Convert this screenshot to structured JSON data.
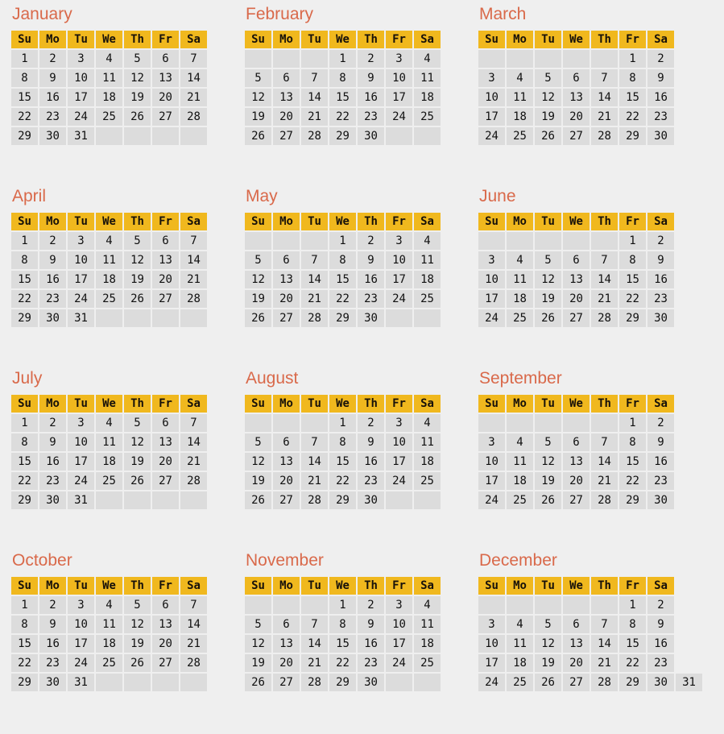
{
  "calendar": {
    "weekday_headers": [
      "Su",
      "Mo",
      "Tu",
      "We",
      "Th",
      "Fr",
      "Sa"
    ],
    "colors": {
      "page_background": "#EFEFEF",
      "header_cell_background": "#F0B81E",
      "header_cell_text": "#17110A",
      "day_cell_background": "#DCDCDC",
      "day_cell_text": "#101010",
      "month_title_text": "#D9694A"
    },
    "months": [
      {
        "name": "January",
        "first_day_index": 0,
        "num_days": 31,
        "weeks": [
          [
            "1",
            "2",
            "3",
            "4",
            "5",
            "6",
            "7"
          ],
          [
            "8",
            "9",
            "10",
            "11",
            "12",
            "13",
            "14"
          ],
          [
            "15",
            "16",
            "17",
            "18",
            "19",
            "20",
            "21"
          ],
          [
            "22",
            "23",
            "24",
            "25",
            "26",
            "27",
            "28"
          ],
          [
            "29",
            "30",
            "31",
            "",
            "",
            "",
            ""
          ]
        ]
      },
      {
        "name": "February",
        "first_day_index": 3,
        "num_days": 30,
        "weeks": [
          [
            "",
            "",
            "",
            "1",
            "2",
            "3",
            "4"
          ],
          [
            "5",
            "6",
            "7",
            "8",
            "9",
            "10",
            "11"
          ],
          [
            "12",
            "13",
            "14",
            "15",
            "16",
            "17",
            "18"
          ],
          [
            "19",
            "20",
            "21",
            "22",
            "23",
            "24",
            "25"
          ],
          [
            "26",
            "27",
            "28",
            "29",
            "30",
            "",
            ""
          ]
        ]
      },
      {
        "name": "March",
        "first_day_index": 5,
        "num_days": 30,
        "weeks": [
          [
            "",
            "",
            "",
            "",
            "",
            "1",
            "2"
          ],
          [
            "3",
            "4",
            "5",
            "6",
            "7",
            "8",
            "9"
          ],
          [
            "10",
            "11",
            "12",
            "13",
            "14",
            "15",
            "16"
          ],
          [
            "17",
            "18",
            "19",
            "20",
            "21",
            "22",
            "23"
          ],
          [
            "24",
            "25",
            "26",
            "27",
            "28",
            "29",
            "30"
          ]
        ]
      },
      {
        "name": "April",
        "first_day_index": 0,
        "num_days": 31,
        "weeks": [
          [
            "1",
            "2",
            "3",
            "4",
            "5",
            "6",
            "7"
          ],
          [
            "8",
            "9",
            "10",
            "11",
            "12",
            "13",
            "14"
          ],
          [
            "15",
            "16",
            "17",
            "18",
            "19",
            "20",
            "21"
          ],
          [
            "22",
            "23",
            "24",
            "25",
            "26",
            "27",
            "28"
          ],
          [
            "29",
            "30",
            "31",
            "",
            "",
            "",
            ""
          ]
        ]
      },
      {
        "name": "May",
        "first_day_index": 3,
        "num_days": 30,
        "weeks": [
          [
            "",
            "",
            "",
            "1",
            "2",
            "3",
            "4"
          ],
          [
            "5",
            "6",
            "7",
            "8",
            "9",
            "10",
            "11"
          ],
          [
            "12",
            "13",
            "14",
            "15",
            "16",
            "17",
            "18"
          ],
          [
            "19",
            "20",
            "21",
            "22",
            "23",
            "24",
            "25"
          ],
          [
            "26",
            "27",
            "28",
            "29",
            "30",
            "",
            ""
          ]
        ]
      },
      {
        "name": "June",
        "first_day_index": 5,
        "num_days": 30,
        "weeks": [
          [
            "",
            "",
            "",
            "",
            "",
            "1",
            "2"
          ],
          [
            "3",
            "4",
            "5",
            "6",
            "7",
            "8",
            "9"
          ],
          [
            "10",
            "11",
            "12",
            "13",
            "14",
            "15",
            "16"
          ],
          [
            "17",
            "18",
            "19",
            "20",
            "21",
            "22",
            "23"
          ],
          [
            "24",
            "25",
            "26",
            "27",
            "28",
            "29",
            "30"
          ]
        ]
      },
      {
        "name": "July",
        "first_day_index": 0,
        "num_days": 31,
        "weeks": [
          [
            "1",
            "2",
            "3",
            "4",
            "5",
            "6",
            "7"
          ],
          [
            "8",
            "9",
            "10",
            "11",
            "12",
            "13",
            "14"
          ],
          [
            "15",
            "16",
            "17",
            "18",
            "19",
            "20",
            "21"
          ],
          [
            "22",
            "23",
            "24",
            "25",
            "26",
            "27",
            "28"
          ],
          [
            "29",
            "30",
            "31",
            "",
            "",
            "",
            ""
          ]
        ]
      },
      {
        "name": "August",
        "first_day_index": 3,
        "num_days": 30,
        "weeks": [
          [
            "",
            "",
            "",
            "1",
            "2",
            "3",
            "4"
          ],
          [
            "5",
            "6",
            "7",
            "8",
            "9",
            "10",
            "11"
          ],
          [
            "12",
            "13",
            "14",
            "15",
            "16",
            "17",
            "18"
          ],
          [
            "19",
            "20",
            "21",
            "22",
            "23",
            "24",
            "25"
          ],
          [
            "26",
            "27",
            "28",
            "29",
            "30",
            "",
            ""
          ]
        ]
      },
      {
        "name": "September",
        "first_day_index": 5,
        "num_days": 30,
        "weeks": [
          [
            "",
            "",
            "",
            "",
            "",
            "1",
            "2"
          ],
          [
            "3",
            "4",
            "5",
            "6",
            "7",
            "8",
            "9"
          ],
          [
            "10",
            "11",
            "12",
            "13",
            "14",
            "15",
            "16"
          ],
          [
            "17",
            "18",
            "19",
            "20",
            "21",
            "22",
            "23"
          ],
          [
            "24",
            "25",
            "26",
            "27",
            "28",
            "29",
            "30"
          ]
        ]
      },
      {
        "name": "October",
        "first_day_index": 0,
        "num_days": 31,
        "weeks": [
          [
            "1",
            "2",
            "3",
            "4",
            "5",
            "6",
            "7"
          ],
          [
            "8",
            "9",
            "10",
            "11",
            "12",
            "13",
            "14"
          ],
          [
            "15",
            "16",
            "17",
            "18",
            "19",
            "20",
            "21"
          ],
          [
            "22",
            "23",
            "24",
            "25",
            "26",
            "27",
            "28"
          ],
          [
            "29",
            "30",
            "31",
            "",
            "",
            "",
            ""
          ]
        ]
      },
      {
        "name": "November",
        "first_day_index": 3,
        "num_days": 30,
        "weeks": [
          [
            "",
            "",
            "",
            "1",
            "2",
            "3",
            "4"
          ],
          [
            "5",
            "6",
            "7",
            "8",
            "9",
            "10",
            "11"
          ],
          [
            "12",
            "13",
            "14",
            "15",
            "16",
            "17",
            "18"
          ],
          [
            "19",
            "20",
            "21",
            "22",
            "23",
            "24",
            "25"
          ],
          [
            "26",
            "27",
            "28",
            "29",
            "30",
            "",
            ""
          ]
        ]
      },
      {
        "name": "December",
        "first_day_index": 5,
        "num_days": 31,
        "weeks": [
          [
            "",
            "",
            "",
            "",
            "",
            "1",
            "2"
          ],
          [
            "3",
            "4",
            "5",
            "6",
            "7",
            "8",
            "9"
          ],
          [
            "10",
            "11",
            "12",
            "13",
            "14",
            "15",
            "16"
          ],
          [
            "17",
            "18",
            "19",
            "20",
            "21",
            "22",
            "23"
          ],
          [
            "24",
            "25",
            "26",
            "27",
            "28",
            "29",
            "30",
            "31"
          ]
        ]
      }
    ]
  }
}
